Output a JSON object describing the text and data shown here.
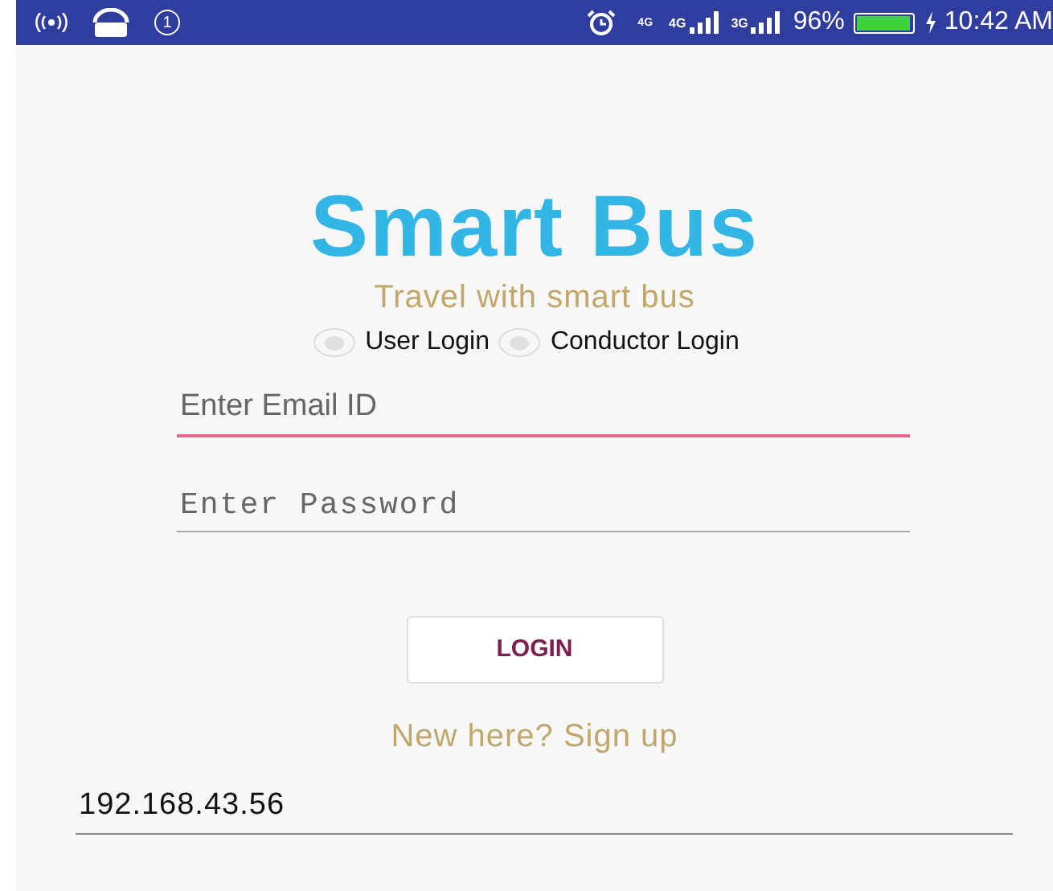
{
  "status_bar": {
    "notification_count": "1",
    "data_type": "4G",
    "networks": [
      {
        "label": "4G"
      },
      {
        "label": "3G"
      }
    ],
    "battery": {
      "reading": "96%",
      "level": 0.96,
      "charging": true
    },
    "time": "10:42 AM"
  },
  "app": {
    "title": "Smart Bus",
    "tagline": "Travel with smart bus",
    "login_types": [
      {
        "label": "User Login",
        "selected": false
      },
      {
        "label": "Conductor Login",
        "selected": false
      }
    ],
    "email": {
      "placeholder": "Enter Email ID",
      "focused": true
    },
    "password": {
      "placeholder": "Enter Password",
      "focused": false
    },
    "login_button": "LOGIN",
    "signup_link": "New here? Sign up",
    "server": {
      "value": "192.168.43.56"
    }
  }
}
